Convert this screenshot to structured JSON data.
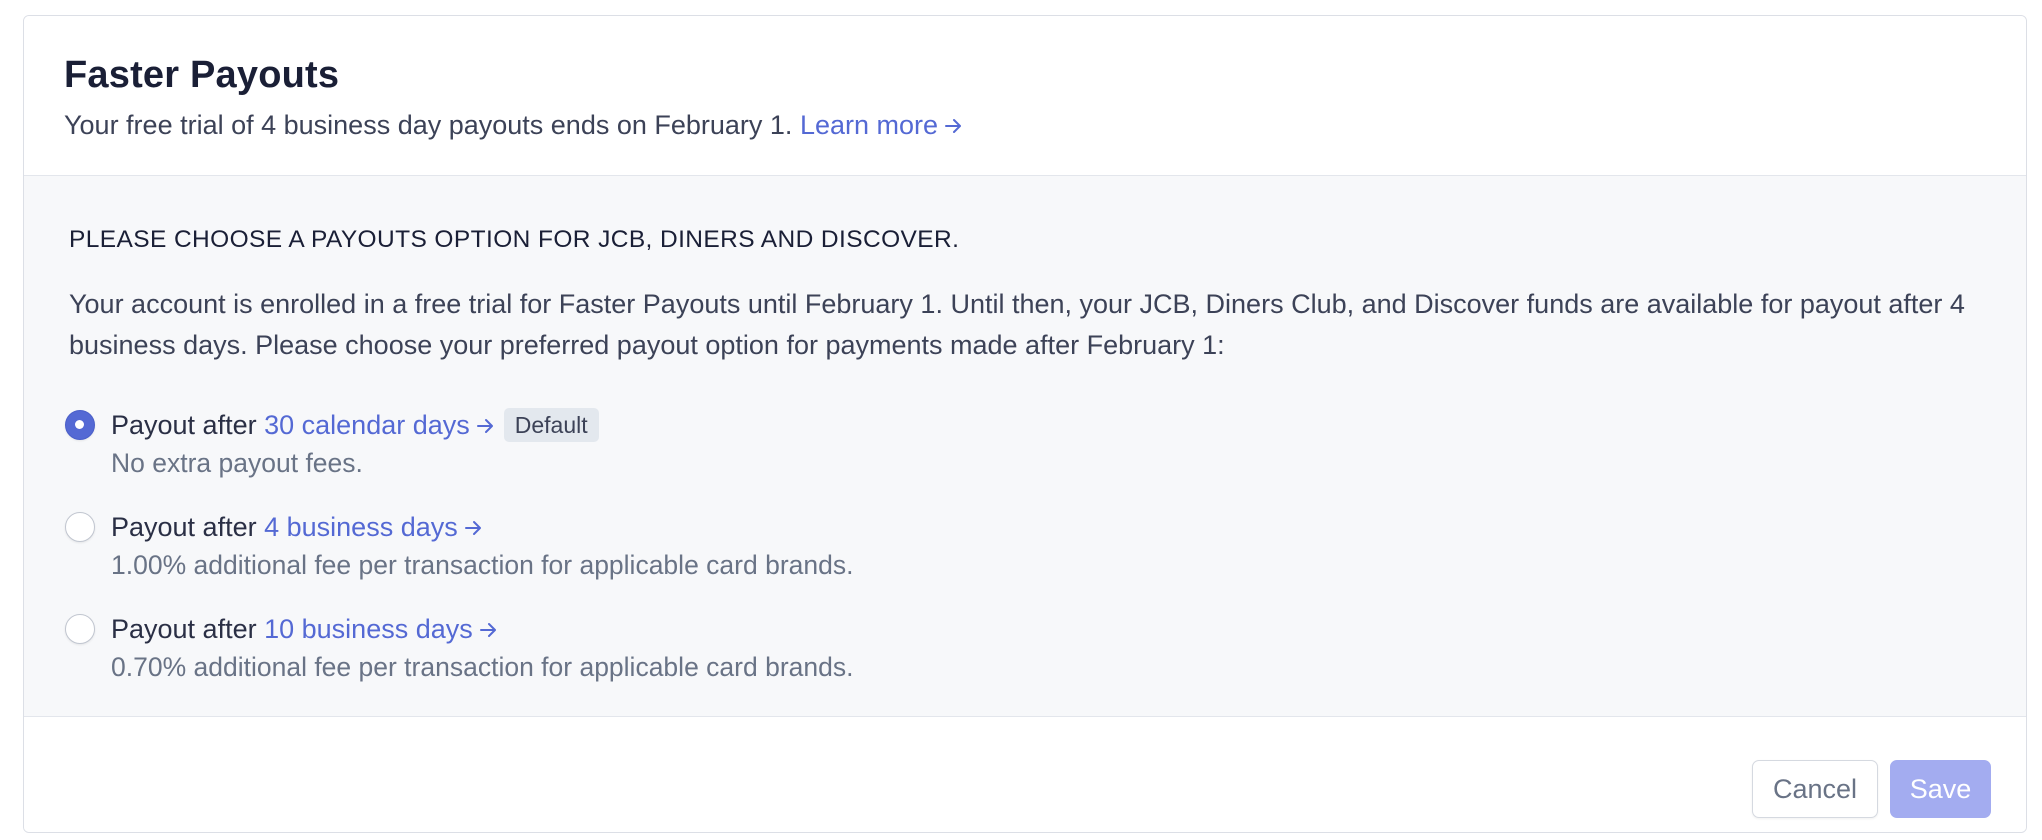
{
  "header": {
    "title": "Faster Payouts",
    "subtitle": "Your free trial of 4 business day payouts ends on February 1.",
    "learn_more": "Learn more"
  },
  "section": {
    "heading": "PLEASE CHOOSE A PAYOUTS OPTION FOR JCB, DINERS AND DISCOVER.",
    "description": "Your account is enrolled in a free trial for Faster Payouts until February 1. Until then, your JCB, Diners Club, and Discover funds are available for payout after 4 business days. Please choose your preferred payout option for payments made after February 1:"
  },
  "options": [
    {
      "prefix": "Payout after",
      "link": "30 calendar days",
      "badge": "Default",
      "description": "No extra payout fees.",
      "selected": true
    },
    {
      "prefix": "Payout after",
      "link": "4 business days",
      "description": "1.00% additional fee per transaction for applicable card brands.",
      "selected": false
    },
    {
      "prefix": "Payout after",
      "link": "10 business days",
      "description": "0.70% additional fee per transaction for applicable card brands.",
      "selected": false
    }
  ],
  "footer": {
    "cancel_label": "Cancel",
    "save_label": "Save"
  },
  "colors": {
    "accent": "#5469d4",
    "save_disabled": "#a3acf0",
    "badge_bg": "#e3e8ee",
    "body_bg": "#f7f8fa"
  },
  "icons": {
    "link_arrow": "arrow-right-icon",
    "radio": "radio-button"
  }
}
